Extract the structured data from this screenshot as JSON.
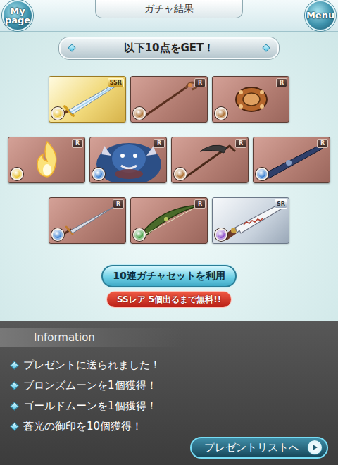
{
  "header": {
    "mypage": [
      "My",
      "page"
    ],
    "title": "ガチャ結果",
    "menu": "Menu"
  },
  "banner": {
    "text": "以下10点をGET！"
  },
  "items": {
    "rows": [
      [
        {
          "rarity": "SSR",
          "kind": "sword",
          "color": "#e8c030"
        },
        {
          "rarity": "R",
          "kind": "staff",
          "color": "#a8692a"
        },
        {
          "rarity": "R",
          "kind": "knuckle",
          "color": "#a8692a"
        }
      ],
      [
        {
          "rarity": "R",
          "kind": "flame",
          "color": "#e8c030"
        },
        {
          "rarity": "R",
          "kind": "beast",
          "color": "#3a7fd0"
        },
        {
          "rarity": "R",
          "kind": "scythe",
          "color": "#a8692a"
        },
        {
          "rarity": "R",
          "kind": "gun",
          "color": "#3a7fd0"
        }
      ],
      [
        {
          "rarity": "R",
          "kind": "dagger",
          "color": "#3a7fd0"
        },
        {
          "rarity": "R",
          "kind": "bow",
          "color": "#3a9a3a"
        },
        {
          "rarity": "SR",
          "kind": "blade",
          "color": "#8a4ac8"
        }
      ]
    ]
  },
  "gacha_button": {
    "label": "10連ガチャセットを利用",
    "note": "SSレア 5個出るまで無料!!"
  },
  "information": {
    "title": "Information",
    "messages": [
      "プレゼントに送られました！",
      "ブロンズムーンを1個獲得！",
      "ゴールドムーンを1個獲得！",
      "蒼光の御印を10個獲得！"
    ]
  },
  "present_button": {
    "label": "プレゼントリストへ"
  }
}
